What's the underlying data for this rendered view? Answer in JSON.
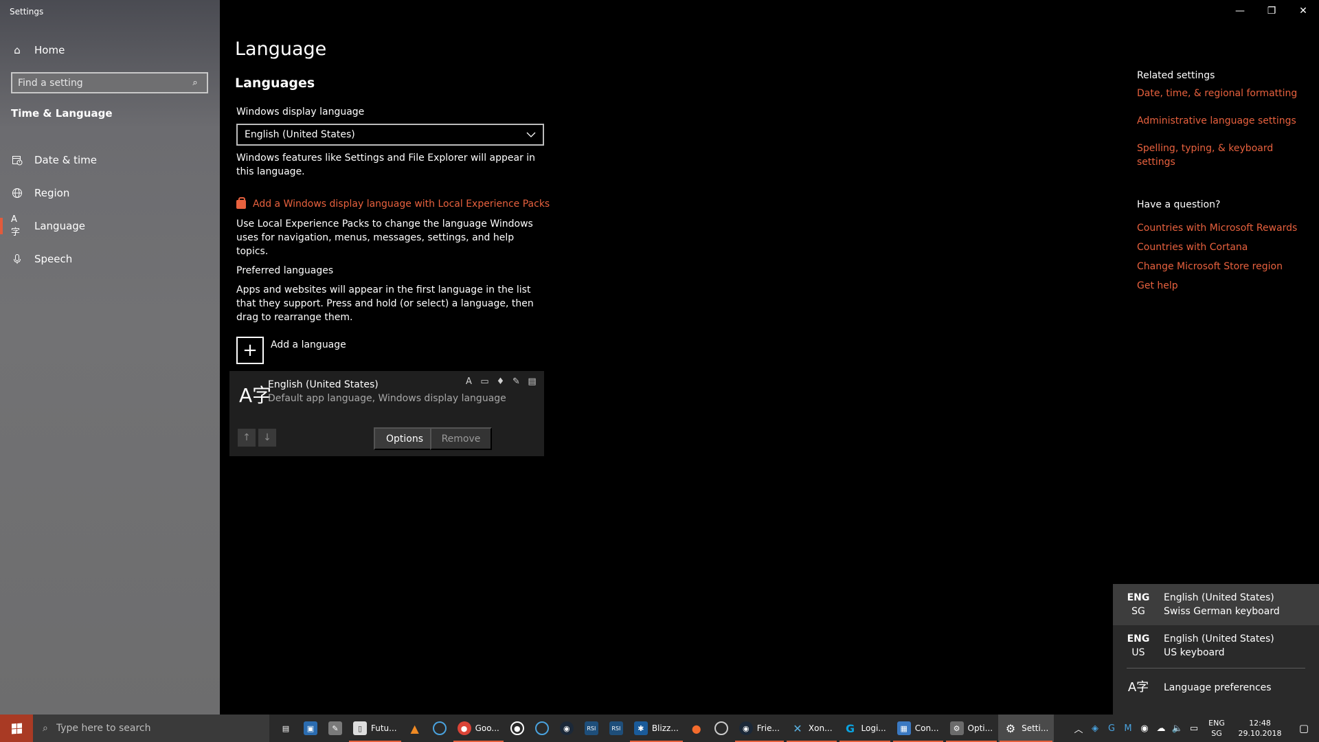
{
  "app": {
    "title": "Settings"
  },
  "sidebar": {
    "home_label": "Home",
    "search_placeholder": "Find a setting",
    "section_title": "Time & Language",
    "items": [
      {
        "label": "Date & time",
        "icon": "calendar-clock-icon"
      },
      {
        "label": "Region",
        "icon": "globe-icon"
      },
      {
        "label": "Language",
        "icon": "language-icon",
        "active": true
      },
      {
        "label": "Speech",
        "icon": "microphone-icon"
      }
    ]
  },
  "main": {
    "title": "Language",
    "subtitle": "Languages",
    "display_language_label": "Windows display language",
    "display_language_value": "English (United States)",
    "display_language_note": "Windows features like Settings and File Explorer will appear in this language.",
    "add_pack_link": "Add a Windows display language with Local Experience Packs",
    "pack_note": "Use Local Experience Packs to change the language Windows uses for navigation, menus, messages, settings, and help topics.",
    "preferred_label": "Preferred languages",
    "preferred_note": "Apps and websites will appear in the first language in the list that they support. Press and hold (or select) a language, then drag to rearrange them.",
    "add_language_label": "Add a language",
    "language_entry": {
      "name": "English (United States)",
      "description": "Default app language, Windows display language",
      "options_label": "Options",
      "remove_label": "Remove"
    }
  },
  "related": {
    "heading": "Related settings",
    "links": [
      "Date, time, & regional formatting",
      "Administrative language settings",
      "Spelling, typing, & keyboard settings"
    ],
    "question_heading": "Have a question?",
    "question_links": [
      "Countries with Microsoft Rewards",
      "Countries with Cortana",
      "Change Microsoft Store region",
      "Get help"
    ]
  },
  "flyout": {
    "items": [
      {
        "code": "ENG",
        "sub": "SG",
        "language": "English (United States)",
        "keyboard": "Swiss German keyboard"
      },
      {
        "code": "ENG",
        "sub": "US",
        "language": "English (United States)",
        "keyboard": "US keyboard"
      }
    ],
    "preferences_label": "Language preferences"
  },
  "taskbar": {
    "search_placeholder": "Type here to search",
    "apps": [
      {
        "label": "",
        "icon": "task-view-icon"
      },
      {
        "label": "",
        "icon": "store-icon"
      },
      {
        "label": "",
        "icon": "paint-icon"
      },
      {
        "label": "Futu...",
        "icon": "document-icon"
      },
      {
        "label": "",
        "icon": "vlc-icon"
      },
      {
        "label": "",
        "icon": "app-icon"
      },
      {
        "label": "Goo...",
        "icon": "chrome-icon"
      },
      {
        "label": "",
        "icon": "target-icon"
      },
      {
        "label": "",
        "icon": "uplay-icon"
      },
      {
        "label": "",
        "icon": "steam-icon"
      },
      {
        "label": "",
        "icon": "rsi-icon"
      },
      {
        "label": "",
        "icon": "rsi-icon"
      },
      {
        "label": "Blizz...",
        "icon": "blizzard-icon"
      },
      {
        "label": "",
        "icon": "origin-icon"
      },
      {
        "label": "",
        "icon": "obs-icon"
      },
      {
        "label": "Frie...",
        "icon": "steam-friends-icon"
      },
      {
        "label": "Xon...",
        "icon": "xonotic-icon"
      },
      {
        "label": "Logi...",
        "icon": "logitech-icon"
      },
      {
        "label": "Con...",
        "icon": "control-panel-icon"
      },
      {
        "label": "Opti...",
        "icon": "options-icon"
      },
      {
        "label": "Setti...",
        "icon": "gear-icon"
      }
    ],
    "lang_code": "ENG",
    "lang_sub": "SG",
    "time": "12:48",
    "date": "29.10.2018"
  },
  "colors": {
    "accent": "#e8613e",
    "start": "#a93a24"
  }
}
